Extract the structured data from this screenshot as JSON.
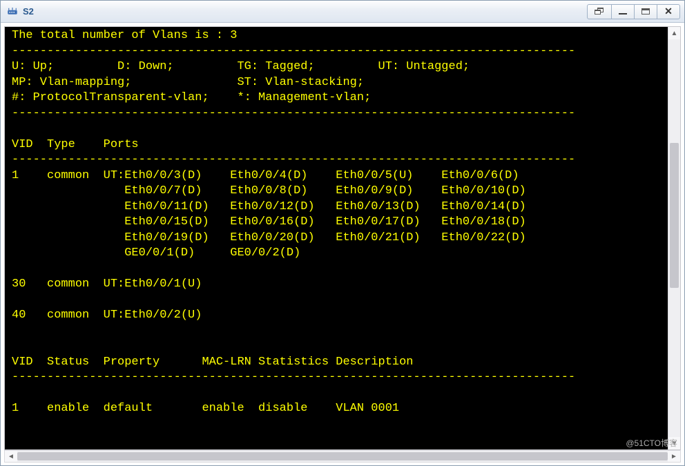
{
  "window": {
    "title": "S2",
    "icon": "network-switch-icon"
  },
  "watermark": "@51CTO博客",
  "terminal": {
    "top_line": "The total number of Vlans is : 3",
    "dash_line": "--------------------------------------------------------------------------------",
    "legend_lines": [
      "U: Up;         D: Down;         TG: Tagged;         UT: Untagged;",
      "MP: Vlan-mapping;               ST: Vlan-stacking;",
      "#: ProtocolTransparent-vlan;    *: Management-vlan;"
    ],
    "table1_header": "VID  Type    Ports",
    "vlans": [
      {
        "vid": "1",
        "type": "common",
        "port_prefix": "UT:",
        "port_lines": [
          [
            "Eth0/0/3(D)",
            "Eth0/0/4(D)",
            "Eth0/0/5(U)",
            "Eth0/0/6(D)"
          ],
          [
            "Eth0/0/7(D)",
            "Eth0/0/8(D)",
            "Eth0/0/9(D)",
            "Eth0/0/10(D)"
          ],
          [
            "Eth0/0/11(D)",
            "Eth0/0/12(D)",
            "Eth0/0/13(D)",
            "Eth0/0/14(D)"
          ],
          [
            "Eth0/0/15(D)",
            "Eth0/0/16(D)",
            "Eth0/0/17(D)",
            "Eth0/0/18(D)"
          ],
          [
            "Eth0/0/19(D)",
            "Eth0/0/20(D)",
            "Eth0/0/21(D)",
            "Eth0/0/22(D)"
          ],
          [
            "GE0/0/1(D)",
            "GE0/0/2(D)"
          ]
        ]
      },
      {
        "vid": "30",
        "type": "common",
        "port_prefix": "UT:",
        "port_lines": [
          [
            "Eth0/0/1(U)"
          ]
        ]
      },
      {
        "vid": "40",
        "type": "common",
        "port_prefix": "UT:",
        "port_lines": [
          [
            "Eth0/0/2(U)"
          ]
        ]
      }
    ],
    "table2_header": "VID  Status  Property      MAC-LRN Statistics Description",
    "status_rows": [
      {
        "vid": "1",
        "status": "enable",
        "property": "default",
        "maclrn": "enable",
        "statistics": "disable",
        "description": "VLAN 0001"
      }
    ]
  }
}
